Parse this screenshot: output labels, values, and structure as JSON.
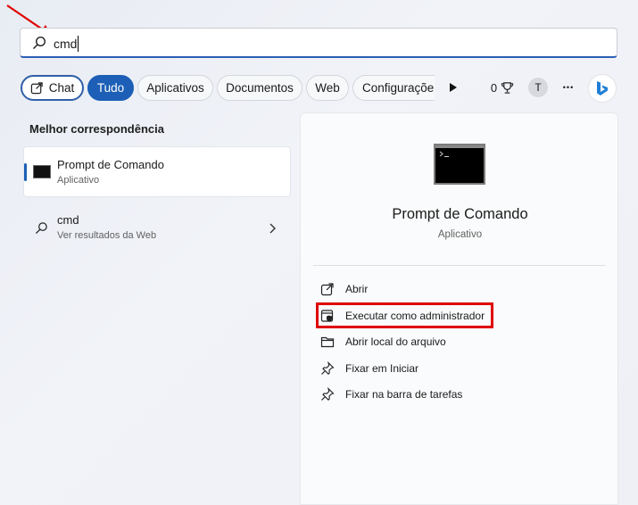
{
  "search": {
    "value": "cmd"
  },
  "chips": {
    "chat": "Chat",
    "all": "Tudo",
    "apps": "Aplicativos",
    "documents": "Documentos",
    "web": "Web",
    "settings": "Configuraçõe"
  },
  "toolbar": {
    "points": "0",
    "avatar_initial": "T",
    "more": "•••"
  },
  "best_match": {
    "heading": "Melhor correspondência",
    "title": "Prompt de Comando",
    "subtitle": "Aplicativo"
  },
  "web_result": {
    "title": "cmd",
    "subtitle": "Ver resultados da Web"
  },
  "detail": {
    "title": "Prompt de Comando",
    "subtitle": "Aplicativo",
    "actions": [
      {
        "label": "Abrir",
        "icon": "open-external-icon"
      },
      {
        "label": "Executar como administrador",
        "icon": "shield-icon"
      },
      {
        "label": "Abrir local do arquivo",
        "icon": "folder-icon"
      },
      {
        "label": "Fixar em Iniciar",
        "icon": "pin-icon"
      },
      {
        "label": "Fixar na barra de tarefas",
        "icon": "pin-icon"
      }
    ]
  },
  "colors": {
    "accent": "#1d5fb6",
    "annotation": "#e00000"
  }
}
